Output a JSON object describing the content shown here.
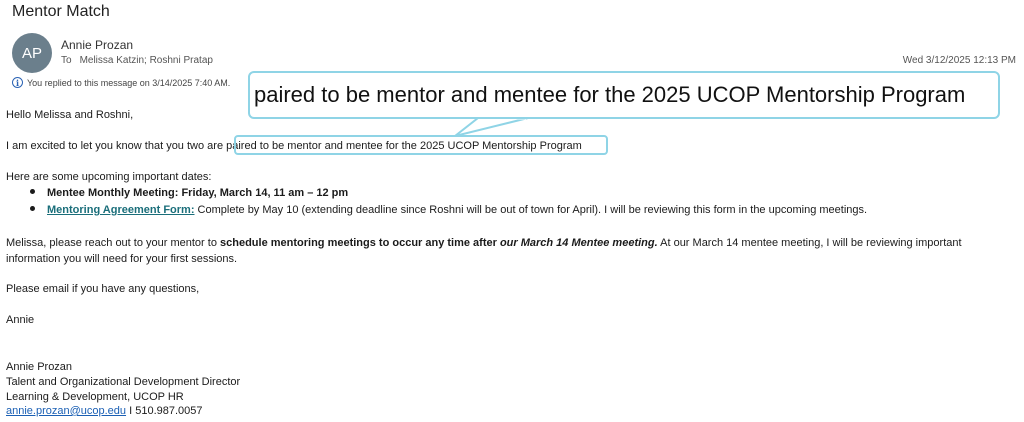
{
  "email": {
    "subject": "Mentor Match",
    "avatar_initials": "AP",
    "sender": "Annie Prozan",
    "to_label": "To",
    "recipients": "Melissa Katzin; Roshni Pratap",
    "date": "Wed 3/12/2025 12:13 PM",
    "replied_notice": "You replied to this message on 3/14/2025 7:40 AM."
  },
  "body": {
    "greeting": "Hello Melissa and Roshni,",
    "excited_prefix": "I am excited to let you know that you two are ",
    "excited_highlight": "paired to be mentor and mentee for the 2025 UCOP Mentorship Program",
    "dates_intro": "Here are some upcoming important dates:",
    "bullet1": "Mentee Monthly Meeting:  Friday, March 14, 11 am – 12 pm",
    "bullet2_link": "Mentoring Agreement Form:",
    "bullet2_rest": " Complete by May 10 (extending deadline since Roshni will be out of town for April).  I will be reviewing this form in the upcoming meetings.",
    "melissa_p1": "Melissa, please reach out to your mentor to ",
    "melissa_bold": "schedule mentoring meetings to occur any time after ",
    "melissa_bold_italic": "our March 14 Mentee meeting.",
    "melissa_p2": "  At our March 14 mentee meeting, I will be reviewing important information you will need for your first sessions.",
    "questions": "Please email if you have any questions,",
    "signoff": "Annie"
  },
  "signature": {
    "name": "Annie Prozan",
    "title": "Talent and Organizational Development Director",
    "dept": "Learning & Development, UCOP HR",
    "email": "annie.prozan@ucop.edu",
    "phone": " I 510.987.0057"
  },
  "callout": {
    "text": "paired to be mentor and mentee for the 2025 UCOP Mentorship Program",
    "border_color": "#8fd4e6"
  }
}
